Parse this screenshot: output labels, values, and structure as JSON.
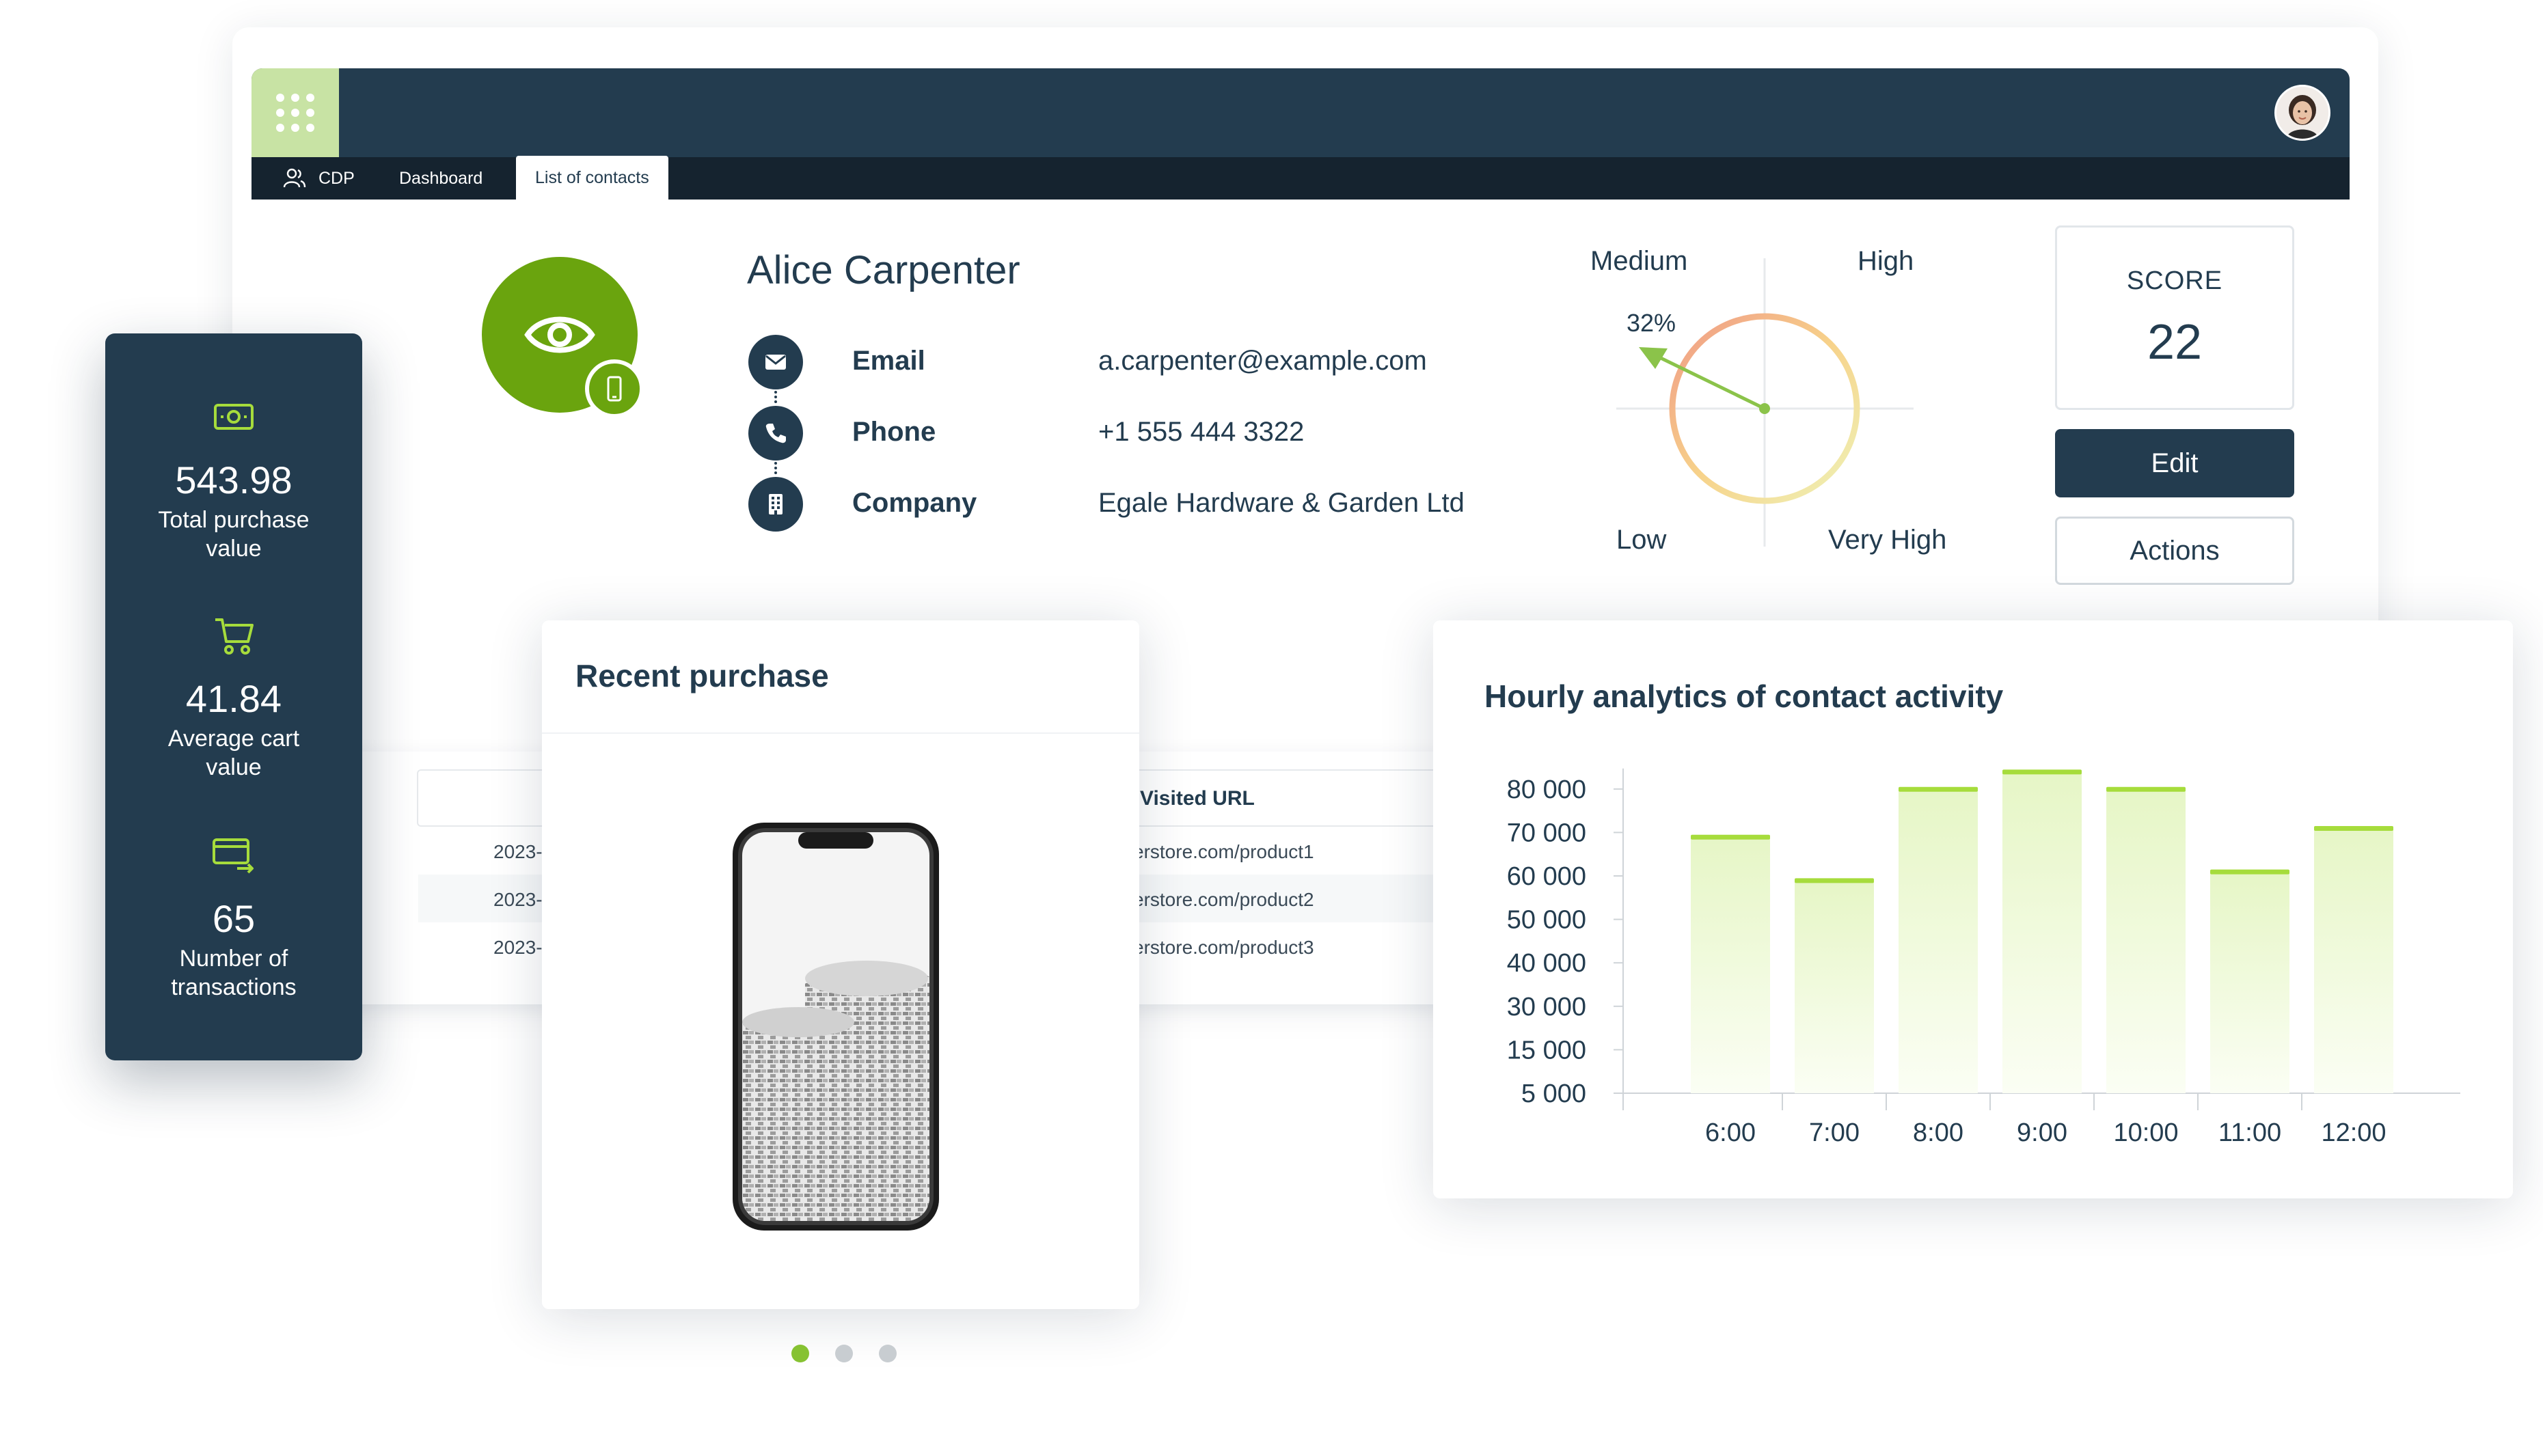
{
  "nav": {
    "cdp_label": "CDP",
    "dashboard_label": "Dashboard",
    "list_label": "List of contacts"
  },
  "contact": {
    "name": "Alice Carpenter",
    "fields": [
      {
        "label": "Email",
        "value": "a.carpenter@example.com",
        "icon": "envelope-icon"
      },
      {
        "label": "Phone",
        "value": "+1 555 444 3322",
        "icon": "phone-icon"
      },
      {
        "label": "Company",
        "value": "Egale Hardware & Garden Ltd",
        "icon": "building-icon"
      }
    ]
  },
  "gauge": {
    "labels": {
      "medium": "Medium",
      "high": "High",
      "low": "Low",
      "very_high": "Very High"
    },
    "percent_label": "32%",
    "percent": 32
  },
  "score": {
    "label": "SCORE",
    "value": "22"
  },
  "buttons": {
    "edit": "Edit",
    "actions": "Actions"
  },
  "stats": [
    {
      "value": "543.98",
      "label_line1": "Total purchase",
      "label_line2": "value",
      "icon": "money-icon"
    },
    {
      "value": "41.84",
      "label_line1": "Average cart",
      "label_line2": "value",
      "icon": "cart-icon"
    },
    {
      "value": "65",
      "label_line1": "Number of",
      "label_line2": "transactions",
      "icon": "card-transfer-icon"
    }
  ],
  "table": {
    "header_url": "Visited URL",
    "rows": [
      {
        "date": "2023-",
        "url": "erstore.com/product1"
      },
      {
        "date": "2023-",
        "url": "erstore.com/product2"
      },
      {
        "date": "2023-",
        "url": "erstore.com/product3"
      }
    ]
  },
  "purchase": {
    "title": "Recent purchase",
    "carousel_active": 0,
    "carousel_count": 3
  },
  "chart_data": {
    "type": "bar",
    "title": "Hourly analytics of contact activity",
    "categories": [
      "6:00",
      "7:00",
      "8:00",
      "9:00",
      "10:00",
      "11:00",
      "12:00"
    ],
    "values": [
      69000,
      59000,
      80000,
      84000,
      80000,
      61000,
      71000
    ],
    "y_tick_labels": [
      "5 000",
      "15 000",
      "30 000",
      "40 000",
      "50 000",
      "60 000",
      "70 000",
      "80 000"
    ],
    "colors": {
      "bar_top": "#a6dc3c",
      "bar_fill": "#e6f6c6"
    }
  }
}
